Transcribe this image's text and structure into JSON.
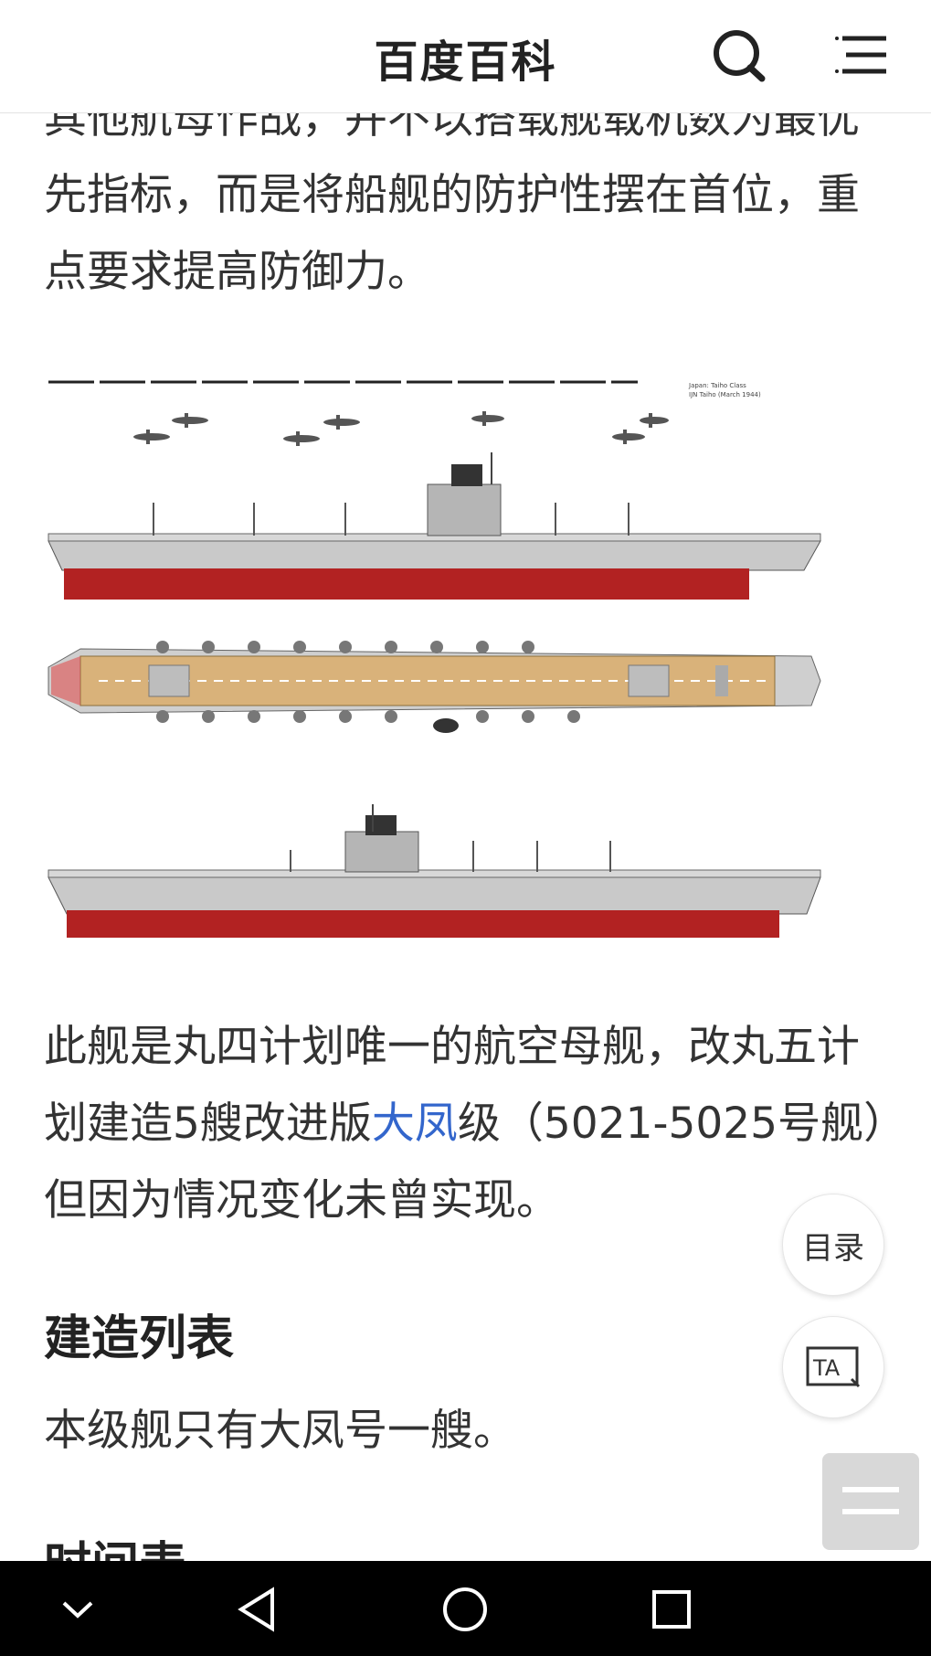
{
  "header": {
    "brand": "百度百科",
    "icons": [
      "search-icon",
      "menu-icon"
    ]
  },
  "article": {
    "intro_partial": "其他航母作战，并不以搭载舰载机数为最优先指标，而是将船舰的防护性摆在首位，重点要求提高防御力。",
    "figure": {
      "caption_line1": "Japan: Taiho Class",
      "caption_line2": "IJN Taiho (March 1944)"
    },
    "para2_before": "此舰是丸四计划唯一的航空母舰，改丸五计划建造5艘改进版",
    "para2_link": "大凤",
    "para2_after": "级（5021-5025号舰）但因为情况变化未曾实现。",
    "section_build": "建造列表",
    "build_text": "本级舰只有大凤号一艘。",
    "section_timeline": "时间表"
  },
  "floating": {
    "toc_label": "目录",
    "font_icon": "font-size-icon",
    "drawer_icon": "drawer-menu-icon"
  },
  "system_nav": {
    "icons": [
      "collapse-icon",
      "back-icon",
      "home-icon",
      "recents-icon"
    ]
  },
  "colors": {
    "link": "#3366cc",
    "hull_red": "#b22222",
    "deck_tan": "#d9b27a",
    "hull_gray": "#c9c9c9",
    "nav_bar": "#000000"
  }
}
